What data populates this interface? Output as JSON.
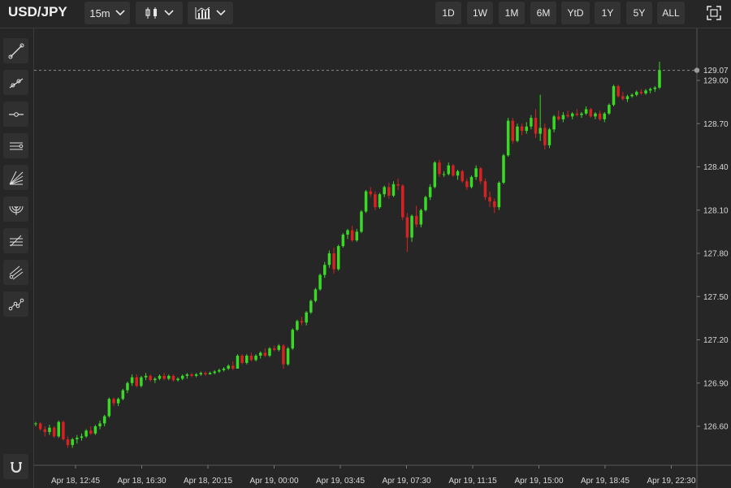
{
  "header": {
    "symbol": "USD/JPY",
    "interval": "15m",
    "chart_type_icon": "candlestick-icon",
    "indicators_icon": "indicators-icon",
    "ranges": [
      "1D",
      "1W",
      "1M",
      "6M",
      "YtD",
      "1Y",
      "5Y",
      "ALL"
    ],
    "fullscreen_icon": "fullscreen-icon"
  },
  "sidebar": {
    "tools": [
      "trend-line-icon",
      "ray-line-icon",
      "horizontal-line-icon",
      "parallel-channel-icon",
      "fib-fan-icon",
      "fib-arc-icon",
      "fib-retracement-icon",
      "pitchfork-icon",
      "path-icon"
    ],
    "magnet_icon": "magnet-icon"
  },
  "colors": {
    "up": "#39d926",
    "down": "#d62222",
    "background": "#262626",
    "grid": "#333333"
  },
  "chart_data": {
    "type": "candlestick",
    "title": "USD/JPY",
    "y_ticks": [
      129.0,
      128.7,
      128.4,
      128.1,
      127.8,
      127.5,
      127.2,
      126.9,
      126.6
    ],
    "y_tick_labels": [
      "129.00",
      "128.70",
      "128.40",
      "128.10",
      "127.80",
      "127.50",
      "127.20",
      "126.90",
      "126.60"
    ],
    "ylim": [
      126.37,
      129.3
    ],
    "x_tick_labels": [
      "Apr 18, 12:45",
      "Apr 18, 16:30",
      "Apr 18, 20:15",
      "Apr 19, 00:00",
      "Apr 19, 03:45",
      "Apr 19, 07:30",
      "Apr 19, 11:15",
      "Apr 19, 15:00",
      "Apr 19, 18:45",
      "Apr 19, 22:30"
    ],
    "last_price": 129.07,
    "last_price_label": "129.07",
    "grid": false,
    "candles": [
      [
        126.62,
        126.63,
        126.6,
        126.62
      ],
      [
        126.62,
        126.63,
        126.57,
        126.58
      ],
      [
        126.58,
        126.6,
        126.53,
        126.56
      ],
      [
        126.56,
        126.61,
        126.54,
        126.59
      ],
      [
        126.59,
        126.6,
        126.52,
        126.53
      ],
      [
        126.53,
        126.64,
        126.52,
        126.63
      ],
      [
        126.63,
        126.64,
        126.5,
        126.51
      ],
      [
        126.51,
        126.53,
        126.45,
        126.47
      ],
      [
        126.47,
        126.52,
        126.45,
        126.51
      ],
      [
        126.51,
        126.54,
        126.48,
        126.52
      ],
      [
        126.52,
        126.55,
        126.5,
        126.53
      ],
      [
        126.53,
        126.58,
        126.52,
        126.57
      ],
      [
        126.57,
        126.6,
        126.54,
        126.55
      ],
      [
        126.55,
        126.61,
        126.54,
        126.6
      ],
      [
        126.6,
        126.64,
        126.58,
        126.62
      ],
      [
        126.62,
        126.68,
        126.6,
        126.67
      ],
      [
        126.67,
        126.8,
        126.66,
        126.79
      ],
      [
        126.79,
        126.8,
        126.74,
        126.76
      ],
      [
        126.76,
        126.8,
        126.74,
        126.79
      ],
      [
        126.79,
        126.86,
        126.78,
        126.85
      ],
      [
        126.85,
        126.91,
        126.83,
        126.9
      ],
      [
        126.9,
        126.96,
        126.88,
        126.94
      ],
      [
        126.94,
        126.96,
        126.87,
        126.88
      ],
      [
        126.88,
        126.95,
        126.87,
        126.94
      ],
      [
        126.94,
        126.97,
        126.92,
        126.95
      ],
      [
        126.95,
        126.96,
        126.91,
        126.92
      ],
      [
        126.92,
        126.94,
        126.9,
        126.93
      ],
      [
        126.93,
        126.96,
        126.92,
        126.95
      ],
      [
        126.95,
        126.97,
        126.92,
        126.93
      ],
      [
        126.93,
        126.96,
        126.92,
        126.95
      ],
      [
        126.95,
        126.96,
        126.91,
        126.92
      ],
      [
        126.92,
        126.94,
        126.91,
        126.93
      ],
      [
        126.93,
        126.96,
        126.92,
        126.95
      ],
      [
        126.95,
        126.97,
        126.93,
        126.96
      ],
      [
        126.96,
        126.97,
        126.94,
        126.95
      ],
      [
        126.95,
        126.97,
        126.94,
        126.96
      ],
      [
        126.96,
        126.98,
        126.95,
        126.97
      ],
      [
        126.97,
        126.98,
        126.95,
        126.96
      ],
      [
        126.96,
        126.98,
        126.96,
        126.97
      ],
      [
        126.97,
        126.99,
        126.96,
        126.98
      ],
      [
        126.98,
        127.0,
        126.97,
        126.99
      ],
      [
        126.99,
        127.01,
        126.98,
        127.0
      ],
      [
        127.0,
        127.03,
        126.99,
        127.02
      ],
      [
        127.02,
        127.05,
        126.99,
        127.0
      ],
      [
        127.0,
        127.1,
        127.0,
        127.09
      ],
      [
        127.09,
        127.1,
        127.03,
        127.04
      ],
      [
        127.04,
        127.1,
        127.03,
        127.09
      ],
      [
        127.09,
        127.11,
        127.05,
        127.06
      ],
      [
        127.06,
        127.1,
        127.05,
        127.09
      ],
      [
        127.09,
        127.12,
        127.07,
        127.11
      ],
      [
        127.11,
        127.14,
        127.08,
        127.09
      ],
      [
        127.09,
        127.15,
        127.08,
        127.14
      ],
      [
        127.14,
        127.16,
        127.12,
        127.13
      ],
      [
        127.13,
        127.17,
        127.12,
        127.16
      ],
      [
        127.16,
        127.17,
        127.0,
        127.03
      ],
      [
        127.03,
        127.15,
        127.02,
        127.14
      ],
      [
        127.14,
        127.28,
        127.13,
        127.27
      ],
      [
        127.27,
        127.34,
        127.26,
        127.33
      ],
      [
        127.33,
        127.36,
        127.3,
        127.32
      ],
      [
        127.32,
        127.4,
        127.3,
        127.39
      ],
      [
        127.39,
        127.48,
        127.38,
        127.47
      ],
      [
        127.47,
        127.56,
        127.46,
        127.55
      ],
      [
        127.55,
        127.66,
        127.54,
        127.65
      ],
      [
        127.65,
        127.74,
        127.63,
        127.72
      ],
      [
        127.72,
        127.82,
        127.7,
        127.8
      ],
      [
        127.8,
        127.84,
        127.66,
        127.69
      ],
      [
        127.69,
        127.86,
        127.68,
        127.85
      ],
      [
        127.85,
        127.94,
        127.84,
        127.93
      ],
      [
        127.93,
        127.97,
        127.9,
        127.96
      ],
      [
        127.96,
        127.99,
        127.88,
        127.89
      ],
      [
        127.89,
        127.97,
        127.88,
        127.95
      ],
      [
        127.95,
        128.1,
        127.94,
        128.09
      ],
      [
        128.09,
        128.24,
        128.08,
        128.23
      ],
      [
        128.23,
        128.26,
        128.19,
        128.21
      ],
      [
        128.21,
        128.23,
        128.1,
        128.12
      ],
      [
        128.12,
        128.22,
        128.11,
        128.21
      ],
      [
        128.21,
        128.27,
        128.19,
        128.26
      ],
      [
        128.26,
        128.29,
        128.18,
        128.2
      ],
      [
        128.2,
        128.3,
        128.19,
        128.28
      ],
      [
        128.28,
        128.32,
        128.24,
        128.27
      ],
      [
        128.27,
        128.28,
        128.03,
        128.05
      ],
      [
        128.05,
        128.08,
        127.81,
        127.91
      ],
      [
        127.91,
        128.07,
        127.88,
        128.06
      ],
      [
        128.06,
        128.13,
        127.98,
        128.0
      ],
      [
        128.0,
        128.11,
        127.98,
        128.1
      ],
      [
        128.1,
        128.2,
        128.09,
        128.19
      ],
      [
        128.19,
        128.28,
        128.17,
        128.26
      ],
      [
        128.26,
        128.44,
        128.25,
        128.43
      ],
      [
        128.43,
        128.45,
        128.33,
        128.35
      ],
      [
        128.35,
        128.37,
        128.33,
        128.35
      ],
      [
        128.35,
        128.43,
        128.34,
        128.41
      ],
      [
        128.41,
        128.42,
        128.33,
        128.34
      ],
      [
        128.34,
        128.38,
        128.31,
        128.37
      ],
      [
        128.37,
        128.38,
        128.29,
        128.3
      ],
      [
        128.3,
        128.32,
        128.24,
        128.26
      ],
      [
        128.26,
        128.34,
        128.25,
        128.33
      ],
      [
        128.33,
        128.41,
        128.31,
        128.39
      ],
      [
        128.39,
        128.4,
        128.28,
        128.3
      ],
      [
        128.3,
        128.32,
        128.17,
        128.19
      ],
      [
        128.19,
        128.23,
        128.12,
        128.16
      ],
      [
        128.16,
        128.18,
        128.08,
        128.12
      ],
      [
        128.12,
        128.3,
        128.1,
        128.29
      ],
      [
        128.29,
        128.49,
        128.28,
        128.48
      ],
      [
        128.48,
        128.74,
        128.47,
        128.72
      ],
      [
        128.72,
        128.74,
        128.56,
        128.58
      ],
      [
        128.58,
        128.7,
        128.57,
        128.68
      ],
      [
        128.68,
        128.7,
        128.62,
        128.65
      ],
      [
        128.65,
        128.71,
        128.63,
        128.68
      ],
      [
        128.68,
        128.76,
        128.66,
        128.74
      ],
      [
        128.74,
        128.8,
        128.6,
        128.63
      ],
      [
        128.63,
        128.9,
        128.58,
        128.67
      ],
      [
        128.67,
        128.7,
        128.52,
        128.55
      ],
      [
        128.55,
        128.67,
        128.53,
        128.66
      ],
      [
        128.66,
        128.76,
        128.64,
        128.75
      ],
      [
        128.75,
        128.79,
        128.72,
        128.73
      ],
      [
        128.73,
        128.78,
        128.71,
        128.76
      ],
      [
        128.76,
        128.79,
        128.74,
        128.75
      ],
      [
        128.75,
        128.78,
        128.73,
        128.77
      ],
      [
        128.77,
        128.8,
        128.75,
        128.76
      ],
      [
        128.76,
        128.78,
        128.74,
        128.77
      ],
      [
        128.77,
        128.82,
        128.76,
        128.8
      ],
      [
        128.8,
        128.81,
        128.74,
        128.75
      ],
      [
        128.75,
        128.78,
        128.73,
        128.77
      ],
      [
        128.77,
        128.79,
        128.72,
        128.73
      ],
      [
        128.73,
        128.78,
        128.71,
        128.77
      ],
      [
        128.77,
        128.84,
        128.76,
        128.83
      ],
      [
        128.83,
        128.97,
        128.82,
        128.96
      ],
      [
        128.96,
        128.97,
        128.88,
        128.89
      ],
      [
        128.89,
        128.92,
        128.86,
        128.87
      ],
      [
        128.87,
        128.9,
        128.85,
        128.89
      ],
      [
        128.89,
        128.91,
        128.88,
        128.9
      ],
      [
        128.9,
        128.93,
        128.89,
        128.92
      ],
      [
        128.92,
        128.94,
        128.9,
        128.91
      ],
      [
        128.91,
        128.94,
        128.9,
        128.93
      ],
      [
        128.93,
        128.95,
        128.91,
        128.94
      ],
      [
        128.94,
        128.96,
        128.92,
        128.95
      ],
      [
        128.95,
        129.13,
        128.94,
        129.07
      ]
    ]
  }
}
